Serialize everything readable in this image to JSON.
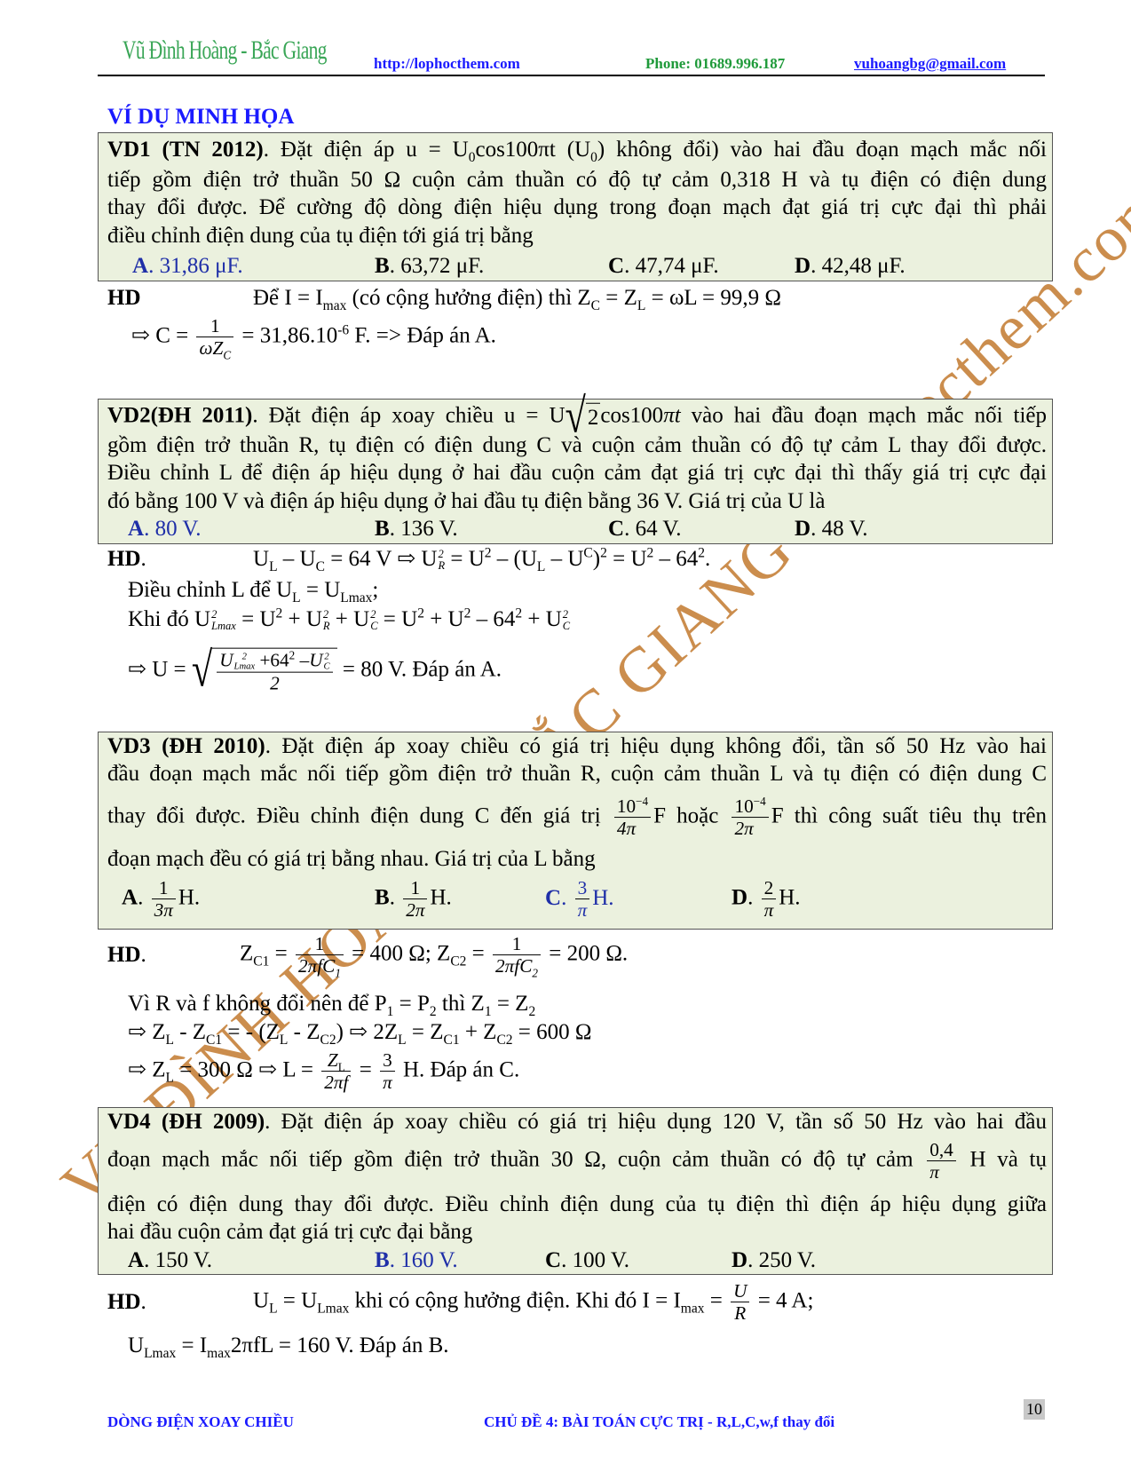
{
  "header": {
    "logo_text": "Vũ Đình Hoàng - Bắc Giang",
    "website": "http://lophocthem.com",
    "phone": "Phone: 01689.996.187",
    "email": "vuhoangbg@gmail.com"
  },
  "watermark": "VŨ ĐÌNH HOÀNG - BẮC GIANG - lophocthem.com",
  "colors": {
    "box_bg": "#ebf1de",
    "heading_blue": "#1a1aff",
    "answer_blue": "#1f2fa8",
    "logo_green": "#3aa657",
    "watermark": "#c27a2e"
  },
  "section_title": "VÍ DỤ MINH HỌA",
  "examples": [
    {
      "lines": [
        [
          {
            "b": "VD1 (TN 2012)"
          },
          ". Đặt điện áp u = U",
          {
            "sub": "0"
          },
          "cos100πt (U",
          {
            "sub": "0"
          },
          ") không đổi) vào hai đầu đoạn mạch mắc nối"
        ],
        [
          "tiếp gồm điện trở thuần 50 Ω cuộn cảm thuần có độ tự cảm 0,318 H và tụ điện có điện dung"
        ],
        [
          "thay đổi được. Để cường độ dòng điện hiệu dụng trong đoạn mạch đạt giá trị cực đại thì phải"
        ],
        [
          "điều chỉnh điện dung của tụ điện tới giá trị bằng"
        ]
      ],
      "options": [
        [
          {
            "blue": [
              {
                "b": "A"
              },
              ". 31,86 μF."
            ]
          }
        ],
        [
          {
            "b": "B"
          },
          ". 63,72 μF."
        ],
        [
          {
            "b": "C"
          },
          ". 47,74 μF."
        ],
        [
          {
            "b": "D"
          },
          ". 42,48 μF."
        ]
      ],
      "hd_label": "HD",
      "solution": [
        [
          "Để I = I",
          {
            "sub": "max"
          },
          " (có cộng hưởng điện) thì Z",
          {
            "sub": "C"
          },
          " = Z",
          {
            "sub": "L"
          },
          " = ωL = 99,9 Ω"
        ],
        [
          "⇨ C = ",
          {
            "frac": [
              [
                "1"
              ],
              [
                {
                  "i": "ωZ"
                },
                {
                  "sub": "C"
                }
              ]
            ]
          },
          " = 31,86.10",
          {
            "sup": "-6"
          },
          " F. => Đáp án A."
        ]
      ]
    },
    {
      "lines": [
        [
          {
            "b": "VD2(ĐH 2011)"
          },
          ". Đặt điện áp xoay chiều u = ",
          "U",
          {
            "sqrt": [
              "2"
            ]
          },
          "cos100",
          {
            "i": "πt"
          },
          "  vào hai đầu đoạn mạch mắc nối tiếp"
        ],
        [
          "gồm điện trở thuần R, tụ điện có điện dung C và cuộn cảm thuần có độ tự cảm L thay đổi được."
        ],
        [
          "Điều chỉnh L để điện áp hiệu dụng ở hai đầu cuộn cảm đạt giá trị cực đại thì thấy giá trị cực đại"
        ],
        [
          "đó bằng 100 V và điện áp hiệu dụng ở hai đầu tụ điện bằng 36 V. Giá trị của U là"
        ]
      ],
      "options": [
        [
          {
            "blue": [
              {
                "b": "A"
              },
              ". 80 V."
            ]
          }
        ],
        [
          {
            "b": "B"
          },
          ". 136 V."
        ],
        [
          {
            "b": "C"
          },
          ". 64 V."
        ],
        [
          {
            "b": "D"
          },
          ". 48 V."
        ]
      ],
      "hd_label": "HD",
      "solution": [
        [
          "U",
          {
            "sub": "L"
          },
          " – U",
          {
            "sub": "C"
          },
          " = 64 V ⇨ U",
          {
            "ss": [
              "2",
              "R"
            ]
          },
          " = U",
          {
            "sup": "2"
          },
          " – (U",
          {
            "sub": "L"
          },
          " – U",
          {
            "sup": "C"
          },
          ")",
          {
            "sup": "2"
          },
          " = U",
          {
            "sup": "2"
          },
          " – 64",
          {
            "sup": "2"
          },
          "."
        ],
        [
          "Điều chỉnh L để U",
          {
            "sub": "L"
          },
          " = U",
          {
            "sub": "Lmax"
          },
          ";"
        ],
        [
          "Khi đó U",
          {
            "ss": [
              "2",
              "Lmax"
            ]
          },
          " = U",
          {
            "sup": "2"
          },
          " + U",
          {
            "ss": [
              "2",
              "R"
            ]
          },
          " + U",
          {
            "ss": [
              "2",
              "C"
            ]
          },
          " = U",
          {
            "sup": "2"
          },
          " + U",
          {
            "sup": "2"
          },
          " – 64",
          {
            "sup": "2"
          },
          " + U",
          {
            "ss": [
              "2",
              "C"
            ]
          }
        ],
        [
          "⇨ U = ",
          {
            "sqrt": [
              {
                "frac": [
                  [
                    {
                      "i": "U"
                    },
                    {
                      "ss": [
                        "2",
                        "Lmax"
                      ]
                    },
                    " +64",
                    {
                      "sup": "2"
                    },
                    " –",
                    {
                      "i": "U"
                    },
                    {
                      "ss": [
                        "2",
                        "C"
                      ]
                    }
                  ],
                  [
                    "2"
                  ]
                ]
              }
            ]
          },
          " = 80 V. Đáp án A."
        ]
      ]
    },
    {
      "lines": [
        [
          {
            "b": "VD3 (ĐH 2010)"
          },
          ". Đặt điện áp xoay chiều có giá trị hiệu dụng không đổi, tần số 50 Hz vào hai"
        ],
        [
          "đầu đoạn mạch mắc nối tiếp gồm điện trở thuần R, cuộn cảm thuần L và tụ điện có điện dung C"
        ],
        [
          "thay đổi được. Điều chỉnh điện dung C đến giá trị ",
          {
            "frac": [
              [
                "10",
                {
                  "sup": "−4"
                }
              ],
              [
                "4π"
              ]
            ]
          },
          "F hoặc ",
          {
            "frac": [
              [
                "10",
                {
                  "sup": "−4"
                }
              ],
              [
                "2π"
              ]
            ]
          },
          "F thì công suất tiêu thụ trên"
        ],
        [
          "đoạn mạch đều có giá trị bằng nhau. Giá trị của L bằng"
        ]
      ],
      "options": [
        [
          {
            "b": "A"
          },
          ". ",
          {
            "frac": [
              [
                "1"
              ],
              [
                "3π"
              ]
            ]
          },
          "H."
        ],
        [
          {
            "b": "B"
          },
          ". ",
          {
            "frac": [
              [
                "1"
              ],
              [
                "2π"
              ]
            ]
          },
          "H."
        ],
        [
          {
            "blue": [
              {
                "b": "C"
              },
              ". ",
              {
                "frac": [
                  [
                    "3"
                  ],
                  [
                    "π"
                  ]
                ]
              },
              "H."
            ]
          }
        ],
        [
          {
            "b": "D"
          },
          ". ",
          {
            "frac": [
              [
                "2"
              ],
              [
                "π"
              ]
            ]
          },
          "H."
        ]
      ],
      "hd_label": "HD",
      "solution": [
        [
          "Z",
          {
            "sub": "C1"
          },
          " = ",
          {
            "frac": [
              [
                "1"
              ],
              [
                "2πfC",
                {
                  "sub": "1"
                }
              ]
            ]
          },
          " = 400 Ω; Z",
          {
            "sub": "C2"
          },
          " = ",
          {
            "frac": [
              [
                "1"
              ],
              [
                "2πfC",
                {
                  "sub": "2"
                }
              ]
            ]
          },
          " = 200 Ω."
        ],
        [
          "Vì R và f không đổi nên để P",
          {
            "sub": "1"
          },
          " = P",
          {
            "sub": "2"
          },
          " thì Z",
          {
            "sub": "1"
          },
          " = Z",
          {
            "sub": "2"
          }
        ],
        [
          "⇨ Z",
          {
            "sub": "L"
          },
          " -  Z",
          {
            "sub": "C1"
          },
          " = - (Z",
          {
            "sub": "L"
          },
          " - Z",
          {
            "sub": "C2"
          },
          ") ⇨ 2Z",
          {
            "sub": "L"
          },
          " = Z",
          {
            "sub": "C1"
          },
          " + Z",
          {
            "sub": "C2"
          },
          " = 600 Ω"
        ],
        [
          "⇨ Z",
          {
            "sub": "L"
          },
          " = 300 Ω ⇨ L = ",
          {
            "frac": [
              [
                {
                  "i": "Z"
                },
                {
                  "sub": "L"
                }
              ],
              [
                "2πf"
              ]
            ]
          },
          " = ",
          {
            "frac": [
              [
                "3"
              ],
              [
                "π"
              ]
            ]
          },
          " H. Đáp án C."
        ]
      ]
    },
    {
      "lines": [
        [
          {
            "b": "VD4 (ĐH 2009)"
          },
          ". Đặt điện áp xoay chiều có giá trị hiệu dụng 120 V, tần số 50 Hz vào hai đầu"
        ],
        [
          "đoạn mạch mắc nối tiếp gồm điện trở thuần    30 Ω, cuộn cảm thuần có độ tự cảm ",
          {
            "frac": [
              [
                "0,4"
              ],
              [
                "π"
              ]
            ]
          },
          " H và tụ"
        ],
        [
          "điện có điện dung thay đổi được. Điều chỉnh điện dung của tụ điện thì điện áp hiệu dụng giữa"
        ],
        [
          "hai đầu cuộn cảm đạt giá trị cực đại bằng"
        ]
      ],
      "options": [
        [
          {
            "b": "A"
          },
          ". 150 V."
        ],
        [
          {
            "blue": [
              {
                "b": "B"
              },
              ". 160 V."
            ]
          }
        ],
        [
          {
            "b": "C"
          },
          ". 100 V."
        ],
        [
          {
            "b": "D"
          },
          ". 250 V."
        ]
      ],
      "hd_label": "HD",
      "solution": [
        [
          "U",
          {
            "sub": "L"
          },
          " = U",
          {
            "sub": "Lmax"
          },
          " khi có cộng hưởng điện. Khi đó I = I",
          {
            "sub": "max"
          },
          " = ",
          {
            "frac": [
              [
                {
                  "i": "U"
                }
              ],
              [
                "R"
              ]
            ]
          },
          " = 4 A;"
        ],
        [
          "U",
          {
            "sub": "Lmax"
          },
          " = I",
          {
            "sub": "max"
          },
          "2πfL = 160 V. Đáp án B."
        ]
      ]
    }
  ],
  "footer": {
    "left": "DÒNG ĐIỆN XOAY CHIỀU",
    "center": "CHỦ ĐỀ 4: BÀI TOÁN CỰC TRỊ - R,L,C,w,f thay đổi",
    "page_number": "10"
  }
}
